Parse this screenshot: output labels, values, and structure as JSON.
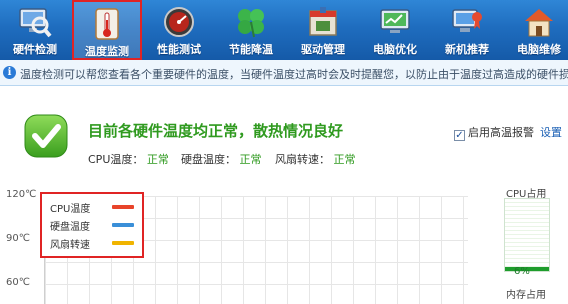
{
  "toolbar": {
    "items": [
      {
        "label": "硬件检测",
        "icon": "magnifier-monitor-icon"
      },
      {
        "label": "温度监测",
        "icon": "thermometer-icon",
        "active": true
      },
      {
        "label": "性能测试",
        "icon": "speedometer-icon"
      },
      {
        "label": "节能降温",
        "icon": "clover-leaf-icon"
      },
      {
        "label": "驱动管理",
        "icon": "driver-box-icon"
      },
      {
        "label": "电脑优化",
        "icon": "optimize-monitor-icon"
      },
      {
        "label": "新机推荐",
        "icon": "new-pc-icon"
      },
      {
        "label": "电脑维修",
        "icon": "repair-house-icon"
      }
    ]
  },
  "info": {
    "text": "温度检测可以帮您查看各个重要硬件的温度，当硬件温度过高时会及时提醒您，以防止由于温度过高造成的硬件损坏"
  },
  "status": {
    "title": "目前各硬件温度均正常，散热情况良好",
    "cpu_label": "CPU温度：",
    "cpu_value": "正常",
    "disk_label": "硬盘温度：",
    "disk_value": "正常",
    "fan_label": "风扇转速：",
    "fan_value": "正常"
  },
  "alarm": {
    "checked": true,
    "label": "启用高温报警",
    "settings_link": "设置"
  },
  "chart": {
    "y_ticks": [
      "120℃",
      "90℃",
      "60℃"
    ],
    "legend": [
      {
        "label": "CPU温度",
        "color": "#e8442a"
      },
      {
        "label": "硬盘温度",
        "color": "#3a8fd8"
      },
      {
        "label": "风扇转速",
        "color": "#f0b400"
      }
    ]
  },
  "side": {
    "cpu_label": "CPU占用",
    "cpu_percent": "6%",
    "cpu_fraction": 0.06,
    "mem_label": "内存占用"
  },
  "colors": {
    "accent_green": "#2f9a1f",
    "active_tab_border": "#e02424",
    "toolbar_blue": "#1f6dbf"
  }
}
